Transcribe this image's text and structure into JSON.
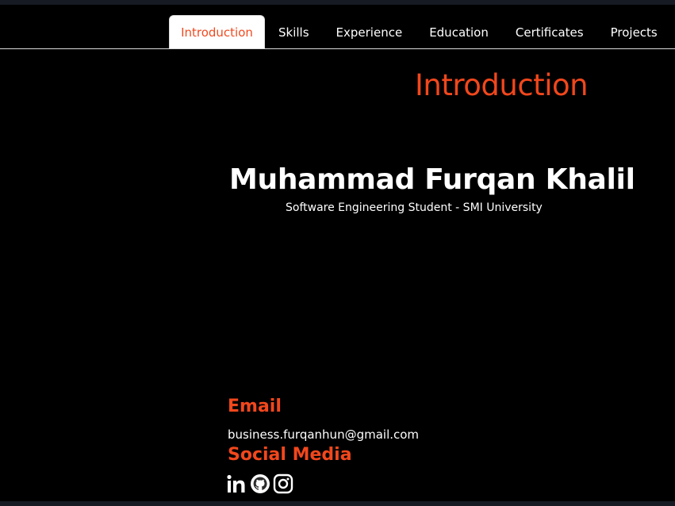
{
  "nav": {
    "tabs": [
      {
        "label": "Introduction",
        "active": true
      },
      {
        "label": "Skills",
        "active": false
      },
      {
        "label": "Experience",
        "active": false
      },
      {
        "label": "Education",
        "active": false
      },
      {
        "label": "Certificates",
        "active": false
      },
      {
        "label": "Projects",
        "active": false
      }
    ]
  },
  "intro": {
    "section_title": "Introduction",
    "name": "Muhammad Furqan Khalil",
    "subtitle": "Software Engineering Student - SMI University"
  },
  "contact": {
    "email_label": "Email",
    "email": "business.furqanhun@gmail.com",
    "social_label": "Social Media",
    "social_icons": [
      "linkedin-icon",
      "github-icon",
      "instagram-icon"
    ]
  },
  "colors": {
    "accent": "#f2471c",
    "background": "#000000",
    "text": "#ffffff"
  }
}
